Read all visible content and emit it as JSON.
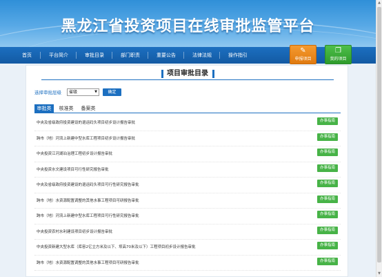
{
  "header": {
    "title": "黑龙江省投资项目在线审批监管平台"
  },
  "nav": {
    "items": [
      {
        "label": "首页"
      },
      {
        "label": "平台简介"
      },
      {
        "label": "审批目录"
      },
      {
        "label": "部门职责"
      },
      {
        "label": "重要公告"
      },
      {
        "label": "法律法规"
      },
      {
        "label": "操作指引"
      }
    ]
  },
  "quick": {
    "apply_label": "申报项目",
    "my_label": "我的项目"
  },
  "panel": {
    "title": "项目审批目录"
  },
  "filter": {
    "label": "选择审批层级",
    "selected": "省级",
    "button": "确定"
  },
  "tabs": [
    {
      "label": "审批类"
    },
    {
      "label": "核准类"
    },
    {
      "label": "备案类"
    }
  ],
  "rows": [
    {
      "text": "中央及省级政府投资建设的退运码头项目初步设计报告审批",
      "button": "办事指南"
    },
    {
      "text": "跨市（地）河流上新建中型水库工程项目初步设计报告审批",
      "button": "办事指南"
    },
    {
      "text": "中央投资江河湖泊治理工程初步设计报告审批",
      "button": "办事指南"
    },
    {
      "text": "中央投资水文建设项目可行性研究报告审批",
      "button": "办事指南"
    },
    {
      "text": "中央及省级政府投资建设的退运码头项目可行性研究报告审批",
      "button": "办事指南"
    },
    {
      "text": "跨市（地）水资源配置调整的其他水事工程项目可研报告审批",
      "button": "办事指南"
    },
    {
      "text": "跨市（地）河流上新建中型水库工程项目可行性研究报告审批",
      "button": "办事指南"
    },
    {
      "text": "中央投资农村水利建设项目初步设计报告审批",
      "button": "办事指南"
    },
    {
      "text": "中央投资新建大型水库（库容2亿立方米及以下、坝高70米及以下）工程项目初步设计报告审批",
      "button": "办事指南"
    },
    {
      "text": "跨市（地）水资源配置调整的其他水事工程项目可研报告审批",
      "button": "办事指南"
    }
  ],
  "colors": {
    "primary": "#1c6fc0",
    "green": "#47b347",
    "orange": "#f08a1f"
  }
}
